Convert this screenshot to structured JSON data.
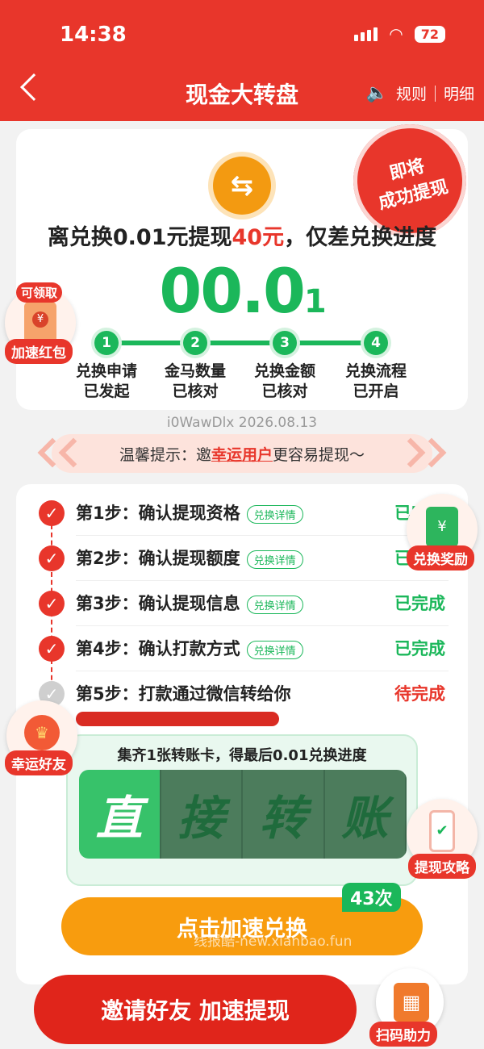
{
  "status": {
    "time": "14:38",
    "battery": "72"
  },
  "nav": {
    "title": "现金大转盘",
    "rules": "规则",
    "details": "明细"
  },
  "top_card": {
    "stamp_line1": "即将",
    "stamp_line2": "成功提现",
    "headline_prefix": "离兑换0.01元提现",
    "headline_amount": "40元",
    "headline_suffix": "，仅差兑换进度",
    "big_number": "00.0",
    "big_number_small": "1",
    "steps": [
      {
        "num": "1",
        "line1": "兑换申请",
        "line2": "已发起"
      },
      {
        "num": "2",
        "line1": "金马数量",
        "line2": "已核对"
      },
      {
        "num": "3",
        "line1": "兑换金额",
        "line2": "已核对"
      },
      {
        "num": "4",
        "line1": "兑换流程",
        "line2": "已开启"
      }
    ]
  },
  "floats": {
    "claimable": "可领取",
    "speed_redpack": "加速红包",
    "exchange_reward": "兑换奖励",
    "lucky_friend": "幸运好友",
    "withdraw_guide": "提现攻略",
    "scan_help": "扫码助力"
  },
  "date_line": "i0WawDlx 2026.08.13",
  "tip": {
    "prefix": "温馨提示：邀",
    "highlight": "幸运用户",
    "suffix": "更容易提现～"
  },
  "withdraw_steps": [
    {
      "label": "第1步：确认提现资格",
      "detail": "兑换详情",
      "status": "已完成"
    },
    {
      "label": "第2步：确认提现额度",
      "detail": "兑换详情",
      "status": "已完成"
    },
    {
      "label": "第3步：确认提现信息",
      "detail": "兑换详情",
      "status": "已完成"
    },
    {
      "label": "第4步：确认打款方式",
      "detail": "兑换详情",
      "status": "已完成"
    },
    {
      "label": "第5步：打款通过微信转给你",
      "detail": "",
      "status": "待完成"
    }
  ],
  "transfer": {
    "title": "集齐1张转账卡，得最后0.01兑换进度",
    "tiles": [
      "直",
      "接",
      "转",
      "账"
    ],
    "count": "43次",
    "button": "点击加速兑换",
    "watermark": "线报酷-new.xianbao.fun"
  },
  "bottom": {
    "invite_button": "邀请好友 加速提现"
  }
}
